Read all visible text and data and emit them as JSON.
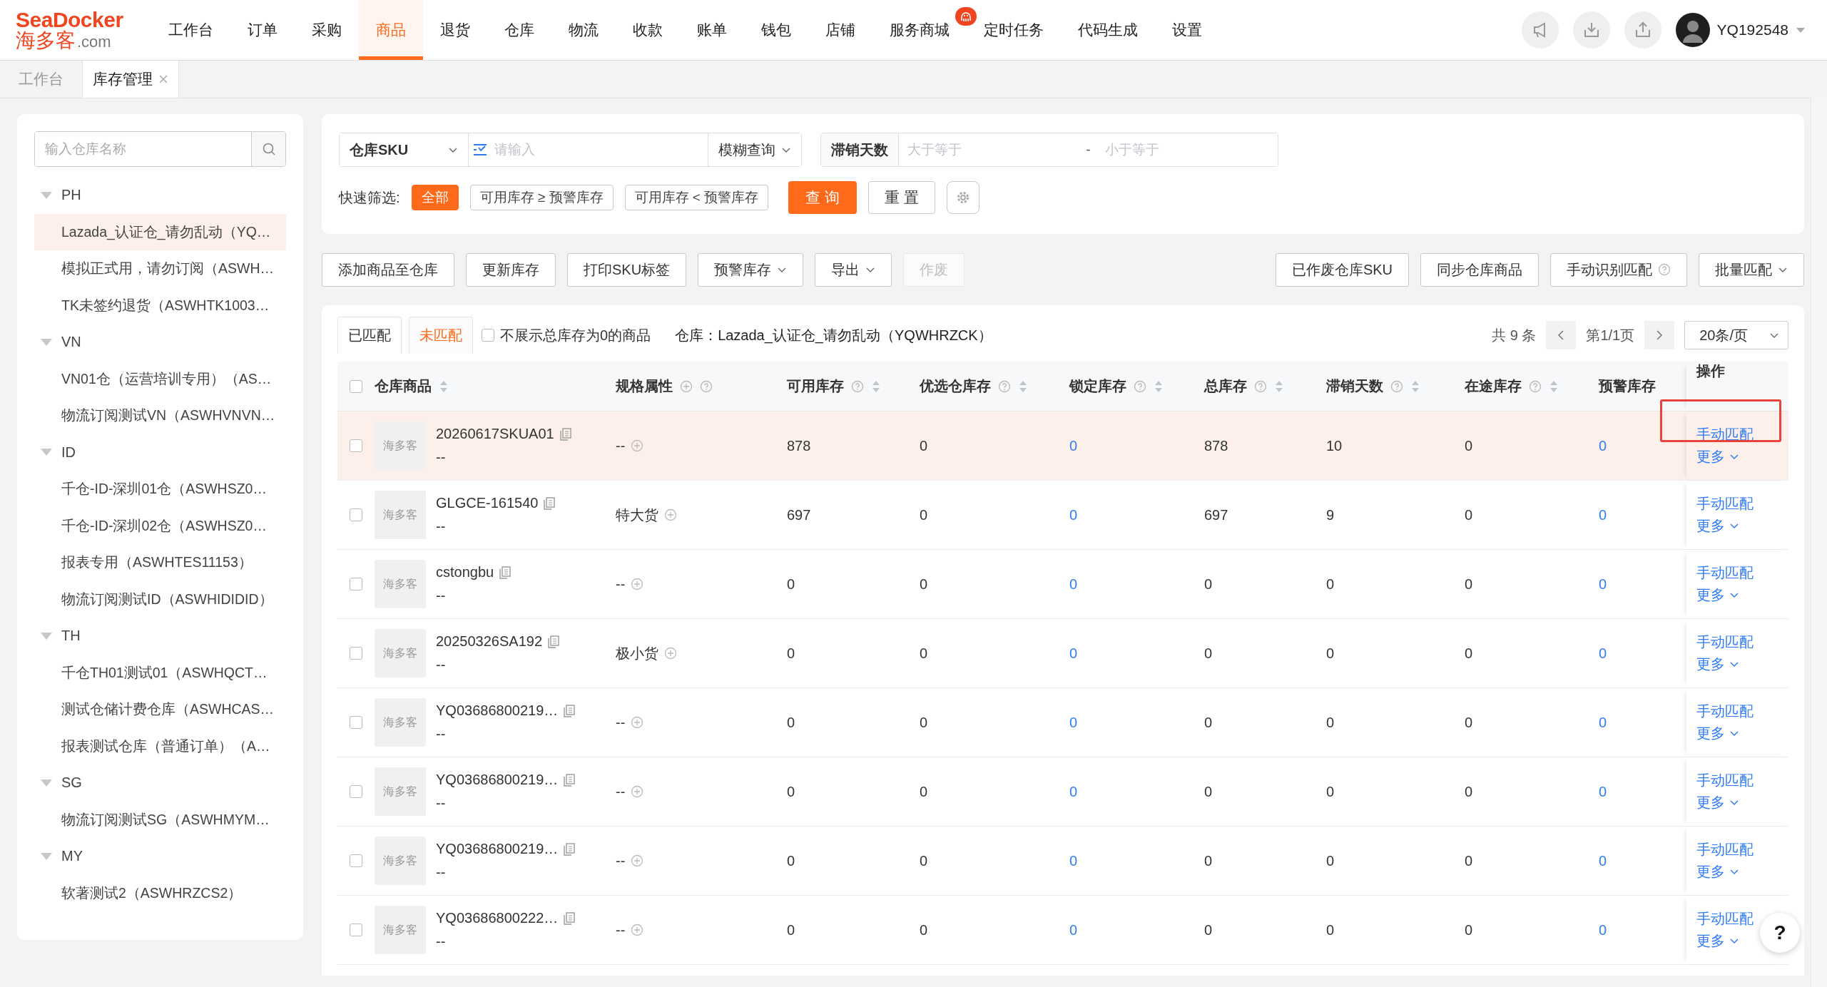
{
  "logo": {
    "brand_latin": "SeaDocker",
    "brand_cn": "海多客",
    "domain": ".com"
  },
  "nav": [
    {
      "label": "工作台",
      "selected": false
    },
    {
      "label": "订单",
      "selected": false
    },
    {
      "label": "采购",
      "selected": false
    },
    {
      "label": "商品",
      "selected": true
    },
    {
      "label": "退货",
      "selected": false
    },
    {
      "label": "仓库",
      "selected": false
    },
    {
      "label": "物流",
      "selected": false
    },
    {
      "label": "收款",
      "selected": false
    },
    {
      "label": "账单",
      "selected": false
    },
    {
      "label": "钱包",
      "selected": false
    },
    {
      "label": "店铺",
      "selected": false
    },
    {
      "label": "服务商城",
      "selected": false,
      "badge": true
    },
    {
      "label": "定时任务",
      "selected": false
    },
    {
      "label": "代码生成",
      "selected": false
    },
    {
      "label": "设置",
      "selected": false
    }
  ],
  "user": {
    "name": "YQ192548"
  },
  "page_tabs": [
    {
      "label": "工作台",
      "selected": false,
      "closable": false
    },
    {
      "label": "库存管理",
      "selected": true,
      "closable": true
    }
  ],
  "sidebar": {
    "search_placeholder": "输入仓库名称",
    "groups": [
      {
        "label": "PH",
        "expanded": true,
        "children": [
          {
            "label": "Lazada_认证仓_请勿乱动（YQ…",
            "selected": true
          },
          {
            "label": "模拟正式用，请勿订阅（ASWH…",
            "selected": false
          },
          {
            "label": "TK未签约退货（ASWHTK1003…",
            "selected": false
          }
        ]
      },
      {
        "label": "VN",
        "expanded": true,
        "children": [
          {
            "label": "VN01仓（运营培训专用）（AS…",
            "selected": false
          },
          {
            "label": "物流订阅测试VN（ASWHVNVN…",
            "selected": false
          }
        ]
      },
      {
        "label": "ID",
        "expanded": true,
        "children": [
          {
            "label": "千仓-ID-深圳01仓（ASWHSZ0…",
            "selected": false
          },
          {
            "label": "千仓-ID-深圳02仓（ASWHSZ0…",
            "selected": false
          },
          {
            "label": "报表专用（ASWHTES11153）",
            "selected": false
          },
          {
            "label": "物流订阅测试ID（ASWHIDIDID）",
            "selected": false
          }
        ]
      },
      {
        "label": "TH",
        "expanded": true,
        "children": [
          {
            "label": "千仓TH01测试01（ASWHQCT…",
            "selected": false
          },
          {
            "label": "测试仓储计费仓库（ASWHCAS…",
            "selected": false
          },
          {
            "label": "报表测试仓库（普通订单）（A…",
            "selected": false
          }
        ]
      },
      {
        "label": "SG",
        "expanded": true,
        "children": [
          {
            "label": "物流订阅测试SG（ASWHMYM…",
            "selected": false
          }
        ]
      },
      {
        "label": "MY",
        "expanded": true,
        "children": [
          {
            "label": "软著测试2（ASWHRZCS2）",
            "selected": false
          }
        ]
      }
    ]
  },
  "filters": {
    "field_select": "仓库SKU",
    "input_placeholder": "请输入",
    "match_select": "模糊查询",
    "days_label": "滞销天数",
    "min_placeholder": "大于等于",
    "separator": "-",
    "max_placeholder": "小于等于",
    "quick_label": "快速筛选:",
    "quick_options": [
      {
        "label": "全部",
        "selected": true
      },
      {
        "label": "可用库存 ≥ 预警库存",
        "selected": false
      },
      {
        "label": "可用库存 < 预警库存",
        "selected": false
      }
    ],
    "search_button": "查 询",
    "reset_button": "重 置"
  },
  "actions_left": [
    {
      "label": "添加商品至仓库",
      "dropdown": false,
      "disabled": false
    },
    {
      "label": "更新库存",
      "dropdown": false,
      "disabled": false
    },
    {
      "label": "打印SKU标签",
      "dropdown": false,
      "disabled": false
    },
    {
      "label": "预警库存",
      "dropdown": true,
      "disabled": false
    },
    {
      "label": "导出",
      "dropdown": true,
      "disabled": false
    },
    {
      "label": "作废",
      "dropdown": false,
      "disabled": true
    }
  ],
  "actions_right": [
    {
      "label": "已作废仓库SKU",
      "dropdown": false,
      "help": false
    },
    {
      "label": "同步仓库商品",
      "dropdown": false,
      "help": false
    },
    {
      "label": "手动识别匹配",
      "dropdown": false,
      "help": true
    },
    {
      "label": "批量匹配",
      "dropdown": true,
      "help": false
    }
  ],
  "match_tabs": [
    {
      "label": "已匹配",
      "selected": false
    },
    {
      "label": "未匹配",
      "selected": true
    }
  ],
  "hide_zero": {
    "label": "不展示总库存为0的商品",
    "checked": false
  },
  "warehouse_label": "仓库：Lazada_认证仓_请勿乱动（YQWHRZCK）",
  "pagination": {
    "total": "共 9 条",
    "page": "第1/1页",
    "page_size": "20条/页"
  },
  "table": {
    "select_all_checked": false,
    "columns": [
      {
        "label": "仓库商品",
        "sortable": true,
        "help": false,
        "add": false
      },
      {
        "label": "规格属性",
        "sortable": false,
        "help": true,
        "add": true
      },
      {
        "label": "可用库存",
        "sortable": true,
        "help": true,
        "add": false
      },
      {
        "label": "优选仓库存",
        "sortable": true,
        "help": true,
        "add": false
      },
      {
        "label": "锁定库存",
        "sortable": true,
        "help": true,
        "add": false
      },
      {
        "label": "总库存",
        "sortable": true,
        "help": true,
        "add": false
      },
      {
        "label": "滞销天数",
        "sortable": true,
        "help": true,
        "add": false
      },
      {
        "label": "在途库存",
        "sortable": true,
        "help": true,
        "add": false
      },
      {
        "label": "预警库存",
        "sortable": false,
        "help": false,
        "add": false
      },
      {
        "label": "操作",
        "sortable": false,
        "help": false,
        "add": false
      }
    ],
    "rows": [
      {
        "highlighted": true,
        "annotated": true,
        "checked": false,
        "thumbnail": "海多客",
        "sku": "20260617SKUA01",
        "sub": "--",
        "spec": "--",
        "available": "878",
        "preferred": "0",
        "locked": "0",
        "total": "878",
        "stale_days": "10",
        "in_transit": "0",
        "warning": "0",
        "action": "手动匹配",
        "more": "更多"
      },
      {
        "highlighted": false,
        "annotated": false,
        "checked": false,
        "thumbnail": "海多客",
        "sku": "GLGCE-161540",
        "sub": "--",
        "spec": "特大货",
        "available": "697",
        "preferred": "0",
        "locked": "0",
        "total": "697",
        "stale_days": "9",
        "in_transit": "0",
        "warning": "0",
        "action": "手动匹配",
        "more": "更多"
      },
      {
        "highlighted": false,
        "annotated": false,
        "checked": false,
        "thumbnail": "海多客",
        "sku": "cstongbu",
        "sub": "--",
        "spec": "--",
        "available": "0",
        "preferred": "0",
        "locked": "0",
        "total": "0",
        "stale_days": "0",
        "in_transit": "0",
        "warning": "0",
        "action": "手动匹配",
        "more": "更多"
      },
      {
        "highlighted": false,
        "annotated": false,
        "checked": false,
        "thumbnail": "海多客",
        "sku": "20250326SA192",
        "sub": "--",
        "spec": "极小货",
        "available": "0",
        "preferred": "0",
        "locked": "0",
        "total": "0",
        "stale_days": "0",
        "in_transit": "0",
        "warning": "0",
        "action": "手动匹配",
        "more": "更多"
      },
      {
        "highlighted": false,
        "annotated": false,
        "checked": false,
        "thumbnail": "海多客",
        "sku": "YQ03686800219…",
        "sub": "--",
        "spec": "--",
        "available": "0",
        "preferred": "0",
        "locked": "0",
        "total": "0",
        "stale_days": "0",
        "in_transit": "0",
        "warning": "0",
        "action": "手动匹配",
        "more": "更多"
      },
      {
        "highlighted": false,
        "annotated": false,
        "checked": false,
        "thumbnail": "海多客",
        "sku": "YQ03686800219…",
        "sub": "--",
        "spec": "--",
        "available": "0",
        "preferred": "0",
        "locked": "0",
        "total": "0",
        "stale_days": "0",
        "in_transit": "0",
        "warning": "0",
        "action": "手动匹配",
        "more": "更多"
      },
      {
        "highlighted": false,
        "annotated": false,
        "checked": false,
        "thumbnail": "海多客",
        "sku": "YQ03686800219…",
        "sub": "--",
        "spec": "--",
        "available": "0",
        "preferred": "0",
        "locked": "0",
        "total": "0",
        "stale_days": "0",
        "in_transit": "0",
        "warning": "0",
        "action": "手动匹配",
        "more": "更多"
      },
      {
        "highlighted": false,
        "annotated": false,
        "checked": false,
        "thumbnail": "海多客",
        "sku": "YQ03686800222…",
        "sub": "--",
        "spec": "--",
        "available": "0",
        "preferred": "0",
        "locked": "0",
        "total": "0",
        "stale_days": "0",
        "in_transit": "0",
        "warning": "0",
        "action": "手动匹配",
        "more": "更多"
      }
    ]
  },
  "help_button": "?"
}
